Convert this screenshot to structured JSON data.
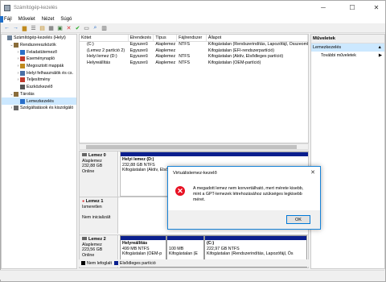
{
  "window": {
    "title": "Számítógép-kezelés"
  },
  "menu": [
    "Fájl",
    "Művelet",
    "Nézet",
    "Súgó"
  ],
  "tree": [
    {
      "label": "Számítógép-kezelés (Helyi)",
      "indent": 0,
      "arrow": ""
    },
    {
      "label": "Rendszereszközök",
      "indent": 1,
      "arrow": "⌄"
    },
    {
      "label": "Feladatütemező",
      "indent": 2,
      "arrow": "›"
    },
    {
      "label": "Eseménynapló",
      "indent": 2,
      "arrow": "›"
    },
    {
      "label": "Megosztott mappák",
      "indent": 2,
      "arrow": "›"
    },
    {
      "label": "Helyi felhasználók és cs.",
      "indent": 2,
      "arrow": "›"
    },
    {
      "label": "Teljesítmény",
      "indent": 2,
      "arrow": "›"
    },
    {
      "label": "Eszközkezelő",
      "indent": 2,
      "arrow": ""
    },
    {
      "label": "Tárolás",
      "indent": 1,
      "arrow": "⌄"
    },
    {
      "label": "Lemezkezelés",
      "indent": 2,
      "arrow": "",
      "selected": true
    },
    {
      "label": "Szolgáltatások és kiszolgáló",
      "indent": 1,
      "arrow": "›"
    }
  ],
  "volume_table": {
    "headers": [
      "Kötet",
      "Elrendezés",
      "Típus",
      "Fájlrendszer",
      "Állapot"
    ],
    "rows": [
      [
        "(C:)",
        "Egyszerű",
        "Alaplemez",
        "NTFS",
        "Kifogástalan (Rendszerindítás, Lapozófájl, Összeomlás"
      ],
      [
        "(Lemez 2 partíció 2)",
        "Egyszerű",
        "Alaplemez",
        "",
        "Kifogástalan (EFI-rendszerpartíció)"
      ],
      [
        "Helyi lemez (D:)",
        "Egyszerű",
        "Alaplemez",
        "NTFS",
        "Kifogástalan (Aktív, Elsődleges partíció)"
      ],
      [
        "Helyreállítás",
        "Egyszerű",
        "Alaplemez",
        "NTFS",
        "Kifogástalan (OEM-partíció)"
      ]
    ]
  },
  "disks": {
    "disk0": {
      "name": "Lemez 0",
      "type": "Alaplemez",
      "size": "232,88 GB",
      "status": "Online",
      "part": {
        "name": "Helyi lemez  (D:)",
        "size": "232,88 GB NTFS",
        "status": "Kifogástalan (Aktív, Elsődl"
      }
    },
    "disk1": {
      "name": "Lemez 1",
      "type": "Ismeretlen",
      "status": "Nem inicializált"
    },
    "disk2": {
      "name": "Lemez 2",
      "type": "Alaplemez",
      "size": "223,56 GB",
      "status": "Online",
      "parts": [
        {
          "name": "Helyreállítás",
          "size": "499 MB NTFS",
          "status": "Kifogástalan (OEM-p"
        },
        {
          "name": "",
          "size": "100 MB",
          "status": "Kifogástalan (E"
        },
        {
          "name": "(C:)",
          "size": "222,97 GB NTFS",
          "status": "Kifogástalan (Rendszerindítás, Lapozófájl, Ös"
        }
      ]
    }
  },
  "legend": [
    {
      "label": "Nem lefoglalt",
      "color": "#000000"
    },
    {
      "label": "Elsődleges partíció",
      "color": "#0a1f8e"
    }
  ],
  "actions": {
    "header": "Műveletek",
    "selected": "Lemezkezelés",
    "more": "További műveletek"
  },
  "dialog": {
    "title": "Virtuálislemez-kezelő",
    "message": "A megadott lemez nem konvertálható, mert mérete kisebb, mint a GPT-lemezek létrehozásához szükséges legkisebb méret.",
    "ok": "OK",
    "icon": "error-icon"
  }
}
